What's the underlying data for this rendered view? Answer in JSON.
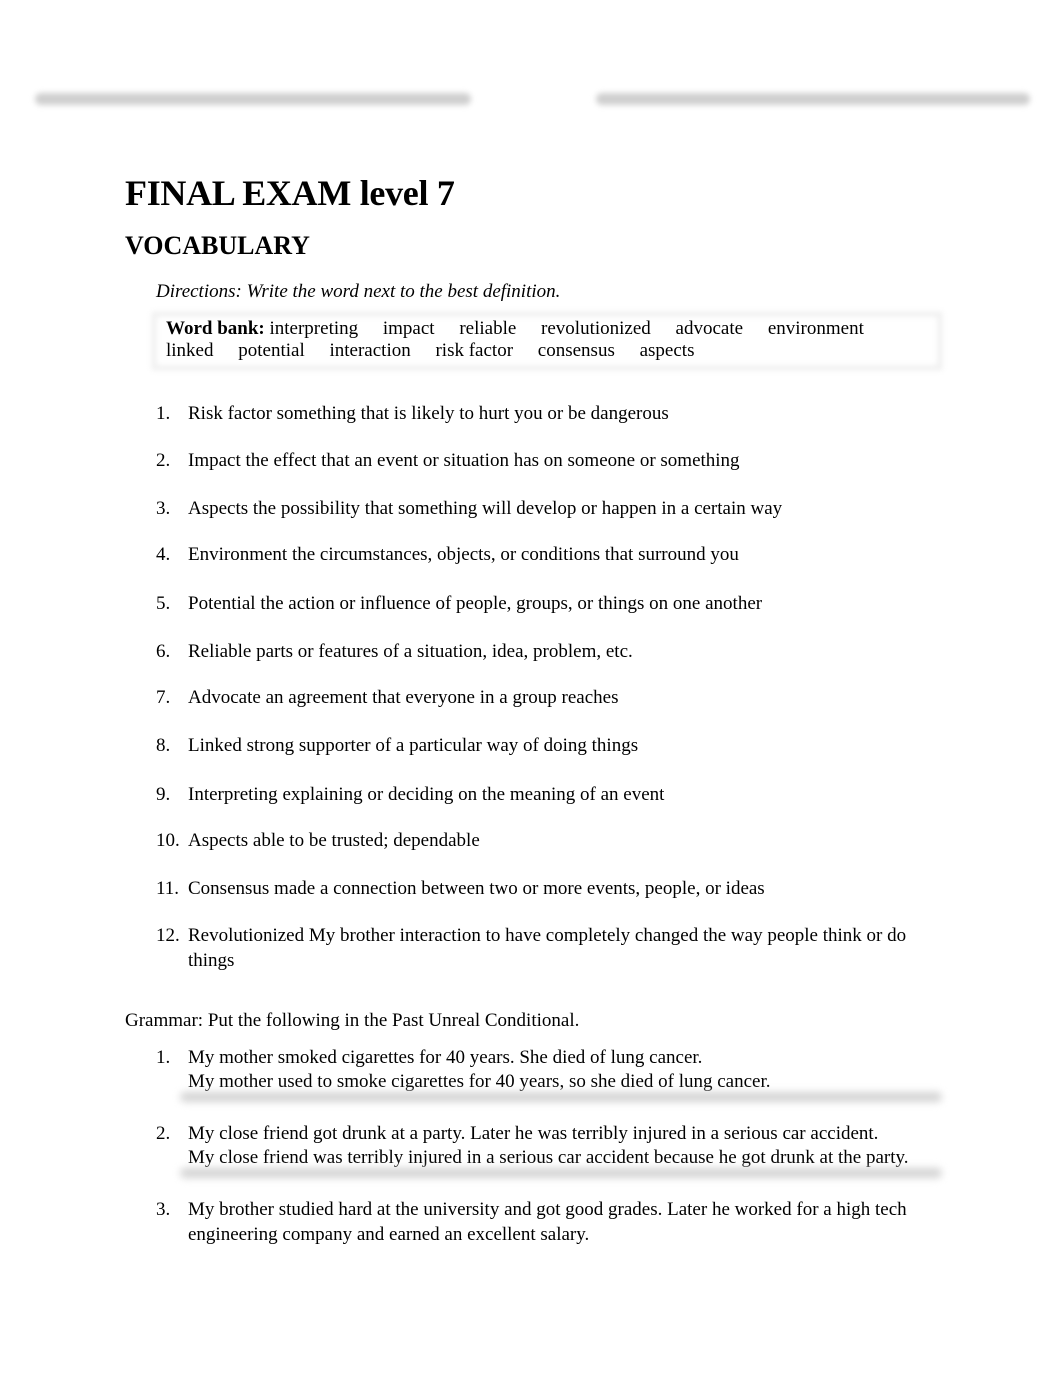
{
  "document": {
    "title": "FINAL EXAM level 7",
    "vocabulary": {
      "heading": "VOCABULARY",
      "directions": "Directions: Write the word next to the best definition.",
      "word_bank": {
        "label": "Word bank:",
        "words": [
          "interpreting",
          "impact",
          "reliable",
          "revolutionized",
          "advocate",
          "environment",
          "linked",
          "potential",
          "interaction",
          "risk factor",
          "consensus",
          "aspects"
        ]
      },
      "items": [
        {
          "number": "1.",
          "answer": "Risk factor",
          "definition": " something that is likely to hurt you or be dangerous"
        },
        {
          "number": "2.",
          "answer": "Impact",
          "definition": " the effect that an event or situation has on someone or something"
        },
        {
          "number": "3.",
          "answer": "Aspects",
          "definition": " the possibility that something will develop or happen in a certain way"
        },
        {
          "number": "4.",
          "answer": "Environment",
          "definition": " the circumstances, objects, or conditions that surround you"
        },
        {
          "number": "5.",
          "answer": "Potential",
          "definition": " the action or influence of people, groups, or things on one another"
        },
        {
          "number": "6.",
          "answer": "Reliable",
          "definition": " parts or features of a situation, idea, problem, etc."
        },
        {
          "number": "7.",
          "answer": "Advocate",
          "definition": " an agreement that everyone in a group reaches"
        },
        {
          "number": "8.",
          "answer": "Linked",
          "definition": " strong supporter of a particular way of doing things"
        },
        {
          "number": "9.",
          "answer": "Interpreting",
          "definition": " explaining or deciding on the meaning of an event"
        },
        {
          "number": "10.",
          "answer": "Aspects",
          "definition": " able to be trusted; dependable"
        },
        {
          "number": "11.",
          "answer": "Consensus",
          "definition": " made a connection between two or more events, people, or ideas"
        },
        {
          "number": "12.",
          "answer": "Revolutionized",
          "extra": " My brother ",
          "answer2": "interaction",
          "definition": " to have completely changed the way people think or do things"
        }
      ]
    },
    "grammar": {
      "heading": "Grammar: Put the following in the Past Unreal Conditional.",
      "items": [
        {
          "number": "1.",
          "prompt": "My mother smoked cigarettes for 40 years. She died of lung cancer.",
          "response": "My mother used to smoke cigarettes for 40 years, so she died of lung cancer."
        },
        {
          "number": "2.",
          "prompt": "My close friend got drunk at a party.  Later he was terribly injured in a serious car accident.",
          "response": "My close friend was terribly injured in a serious car accident because he got drunk at the party."
        },
        {
          "number": "3.",
          "prompt": "My brother studied hard at the university and got good grades. Later he worked for a high tech engineering company and earned an excellent salary.",
          "response": ""
        }
      ]
    }
  }
}
